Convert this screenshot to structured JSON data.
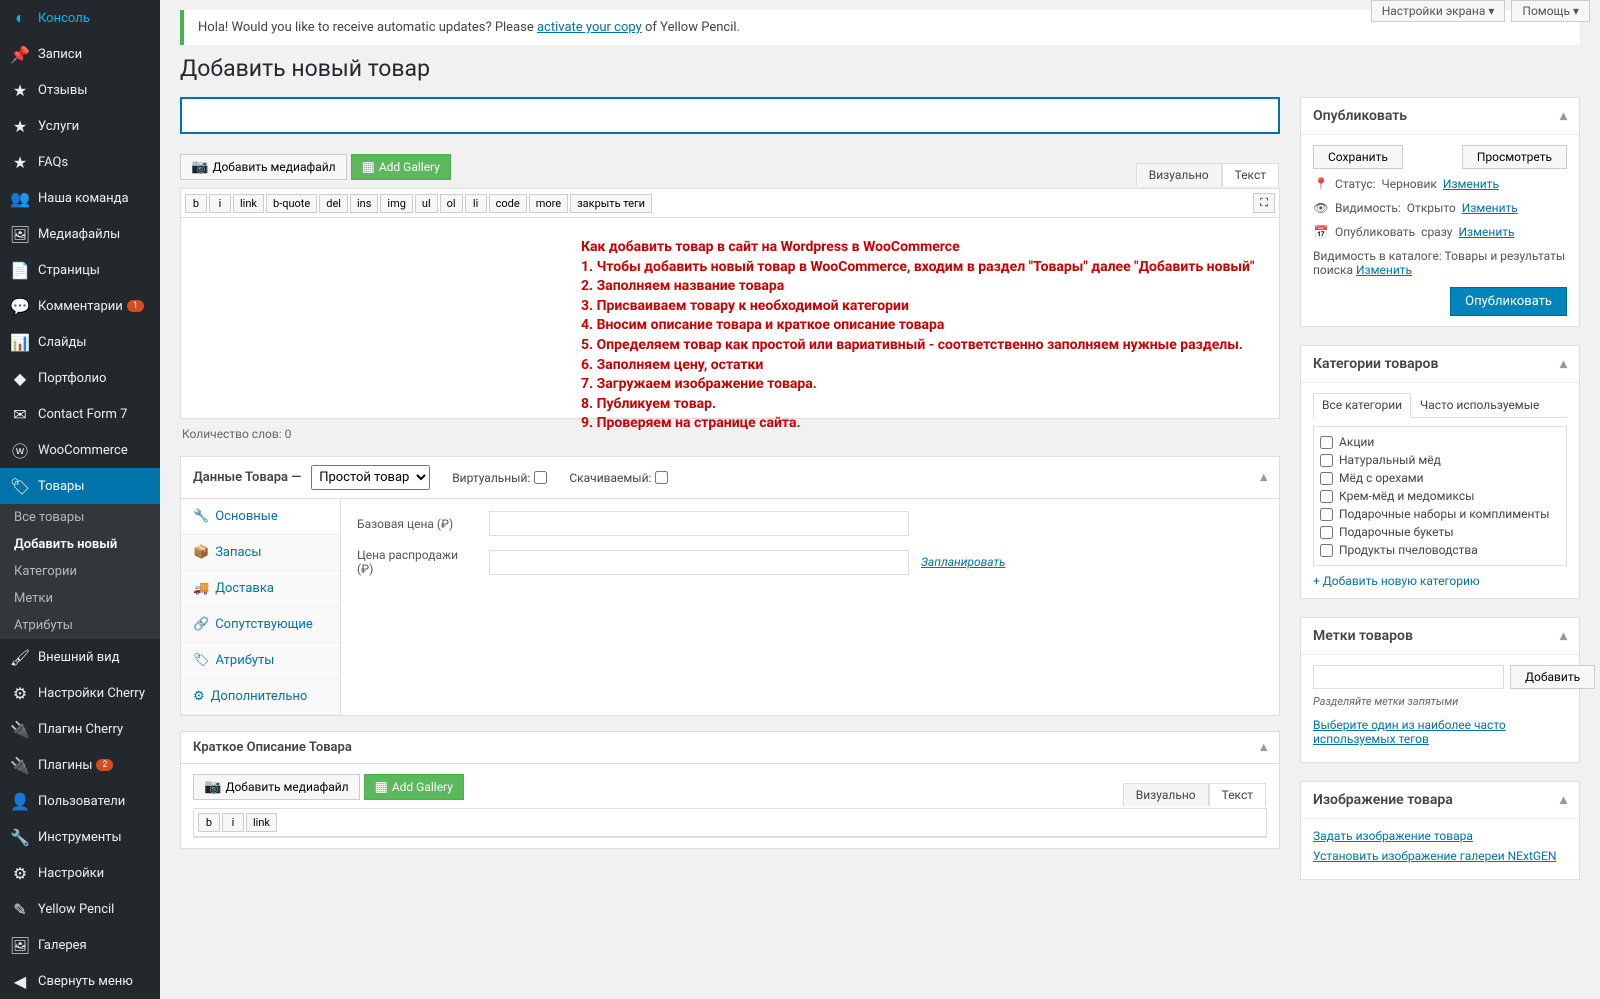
{
  "topButtons": {
    "settings": "Настройки экрана",
    "help": "Помощь"
  },
  "sidebar": {
    "items": [
      {
        "label": "Консоль",
        "icon": "◐"
      },
      {
        "label": "Записи",
        "icon": "📌"
      },
      {
        "label": "Отзывы",
        "icon": "★"
      },
      {
        "label": "Услуги",
        "icon": "★"
      },
      {
        "label": "FAQs",
        "icon": "★"
      },
      {
        "label": "Наша команда",
        "icon": "👥"
      },
      {
        "label": "Медиафайлы",
        "icon": "🖼"
      },
      {
        "label": "Страницы",
        "icon": "📄"
      },
      {
        "label": "Комментарии",
        "icon": "💬",
        "badge": "1"
      },
      {
        "label": "Слайды",
        "icon": "📊"
      },
      {
        "label": "Портфолио",
        "icon": "◆"
      },
      {
        "label": "Contact Form 7",
        "icon": "✉"
      },
      {
        "label": "WooCommerce",
        "icon": "ⓦ"
      },
      {
        "label": "Товары",
        "icon": "🏷",
        "active": true
      },
      {
        "label": "Внешний вид",
        "icon": "🖌"
      },
      {
        "label": "Настройки Cherry",
        "icon": "⚙"
      },
      {
        "label": "Плагин Cherry",
        "icon": "🔌"
      },
      {
        "label": "Плагины",
        "icon": "🔌",
        "badge": "2"
      },
      {
        "label": "Пользователи",
        "icon": "👤"
      },
      {
        "label": "Инструменты",
        "icon": "🔧"
      },
      {
        "label": "Настройки",
        "icon": "⚙"
      },
      {
        "label": "Yellow Pencil",
        "icon": "✎"
      },
      {
        "label": "Галерея",
        "icon": "🖼"
      },
      {
        "label": "Свернуть меню",
        "icon": "◀"
      }
    ],
    "submenu": [
      {
        "label": "Все товары"
      },
      {
        "label": "Добавить новый",
        "active": true
      },
      {
        "label": "Категории"
      },
      {
        "label": "Метки"
      },
      {
        "label": "Атрибуты"
      }
    ]
  },
  "notice": {
    "text": "Hola! Would you like to receive automatic updates? Please ",
    "link": "activate your copy",
    "text2": " of Yellow Pencil."
  },
  "pageTitle": "Добавить новый товар",
  "mediaButtons": {
    "add": "Добавить медиафайл",
    "gallery": "Add Gallery"
  },
  "editor": {
    "tabs": {
      "visual": "Визуально",
      "text": "Текст"
    },
    "toolbar": [
      "b",
      "i",
      "link",
      "b-quote",
      "del",
      "ins",
      "img",
      "ul",
      "ol",
      "li",
      "code",
      "more",
      "закрыть теги"
    ],
    "wordCount": "Количество слов: 0"
  },
  "overlay": "Как добавить товар в сайт на Wordpress в WooCommerce\n1. Чтобы добавить новый товар в WooCommerce, входим в раздел \"Товары\" далее \"Добавить новый\"\n2. Заполняем название товара\n3. Присваиваем товару к необходимой категории\n4. Вносим описание товара и краткое описание товара\n5. Определяем товар как простой или вариативный - соответственно заполняем нужные разделы.\n6. Заполняем цену, остатки\n7. Загружаем изображение товара.\n8. Публикуем товар.\n9. Проверяем на странице сайта.",
  "productData": {
    "title": "Данные Товара —",
    "type": "Простой товар",
    "virtual": "Виртуальный:",
    "downloadable": "Скачиваемый:",
    "tabs": [
      "Основные",
      "Запасы",
      "Доставка",
      "Сопутствующие",
      "Атрибуты",
      "Дополнительно"
    ],
    "basePrice": "Базовая цена (₽)",
    "salePrice": "Цена распродажи (₽)",
    "schedule": "Запланировать"
  },
  "shortDesc": {
    "title": "Краткое Описание Товара",
    "toolbar": [
      "b",
      "i",
      "link"
    ]
  },
  "publish": {
    "title": "Опубликовать",
    "save": "Сохранить",
    "preview": "Просмотреть",
    "status": "Статус:",
    "statusVal": "Черновик",
    "edit": "Изменить",
    "vis": "Видимость:",
    "visVal": "Открыто",
    "pub": "Опубликовать",
    "pubVal": "сразу",
    "catVis": "Видимость в каталоге:",
    "catVisVal": "Товары и результаты поиска",
    "publishBtn": "Опубликовать"
  },
  "categories": {
    "title": "Категории товаров",
    "tabAll": "Все категории",
    "tabFreq": "Часто используемые",
    "items": [
      "Акции",
      "Натуральный мёд",
      "Мёд с орехами",
      "Крем-мёд и медомиксы",
      "Подарочные наборы и комплименты",
      "Подарочные букеты",
      "Продукты пчеловодства"
    ],
    "addNew": "+ Добавить новую категорию"
  },
  "tags": {
    "title": "Метки товаров",
    "add": "Добавить",
    "help": "Разделяйте метки запятыми",
    "popular": "Выберите один из наиболее часто используемых тегов"
  },
  "image": {
    "title": "Изображение товара",
    "setImage": "Задать изображение товара",
    "nextgen": "Установить изображение галереи NExtGEN"
  }
}
